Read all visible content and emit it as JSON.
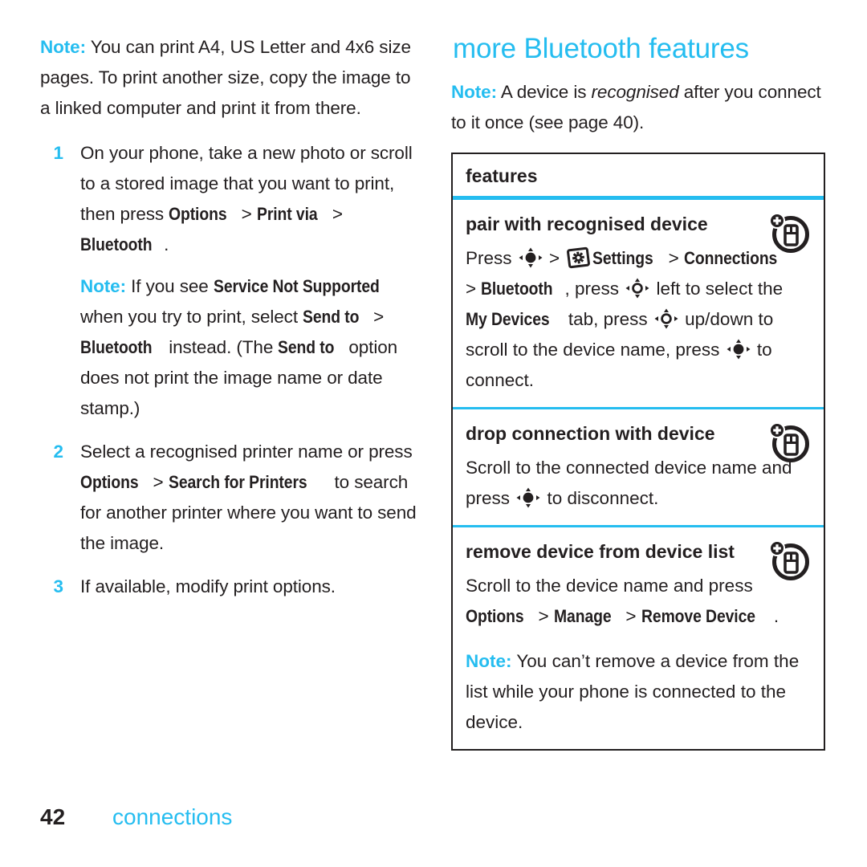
{
  "document": {
    "footer": {
      "page_number": "42",
      "section_name": "connections"
    },
    "accent_color": "#25bdf0",
    "text_color": "#231f20"
  },
  "left_column": {
    "intro_note": {
      "label": "Note:",
      "text": " You can print A4, US Letter and 4x6 size pages. To print another size, copy the image to a linked computer and print it from there."
    },
    "steps": [
      {
        "number": "1",
        "text_a": "On your phone, take a new photo or scroll to a stored image that you want to print, then press ",
        "ui_1": "Options",
        "sep_1": " > ",
        "ui_2": "Print via",
        "sep_2": " > ",
        "ui_3": "Bluetooth",
        "text_b": ".",
        "note": {
          "label": "Note:",
          "text_a": " If you see ",
          "ui_1": "Service Not Supported",
          "text_b": " when you try to print, select ",
          "ui_2": "Send to",
          "sep_1": " > ",
          "ui_3": "Bluetooth",
          "text_c": " instead. (The ",
          "ui_4": "Send to",
          "text_d": " option does not print the image name or date stamp.)"
        }
      },
      {
        "number": "2",
        "text_a": "Select a recognised printer name or press ",
        "ui_1": "Options",
        "sep_1": " > ",
        "ui_2": "Search for Printers",
        "text_b": " to search for another printer where you want to send the image."
      },
      {
        "number": "3",
        "text_a": "If available, modify print options."
      }
    ]
  },
  "right_column": {
    "heading": "more Bluetooth features",
    "intro_note": {
      "label": "Note:",
      "text_a": " A device is ",
      "italic": "recognised",
      "text_b": " after you connect to it once (see page 40)."
    },
    "card": {
      "header": "features",
      "sections": [
        {
          "title": "pair with recognised device",
          "icon": "add-device-icon",
          "body": {
            "t1": "Press ",
            "icon_nav_select": "navigation-key-select-icon",
            "t2": " > ",
            "icon_gear": "settings-gear-icon",
            "ui_1": " Settings",
            "sep_1": " > ",
            "ui_2": "Connections",
            "t3": " > ",
            "ui_3": "Bluetooth",
            "t4": ", press ",
            "icon_nav_ring": "navigation-key-icon",
            "t5": " left to select the ",
            "ui_4": "My Devices",
            "t6": " tab, press ",
            "icon_nav_ring_2": "navigation-key-icon",
            "t7": " up/down to scroll to the device name, press ",
            "icon_nav_select_2": "navigation-key-select-icon",
            "t8": " to connect."
          }
        },
        {
          "title": "drop connection with device",
          "icon": "add-device-icon",
          "body": {
            "t1": "Scroll to the connected device name and press ",
            "icon_nav_select": "navigation-key-select-icon",
            "t2": " to disconnect."
          }
        },
        {
          "title": "remove device from device list",
          "icon": "add-device-icon",
          "body": {
            "t1": "Scroll to the device name and press ",
            "ui_1": "Options",
            "sep_1": " > ",
            "ui_2": "Manage",
            "sep_2": " > ",
            "ui_3": "Remove Device",
            "t2": "."
          }
        }
      ],
      "footer_note": {
        "label": "Note:",
        "text": " You can’t remove a device from the list while your phone is connected to the device."
      }
    }
  }
}
